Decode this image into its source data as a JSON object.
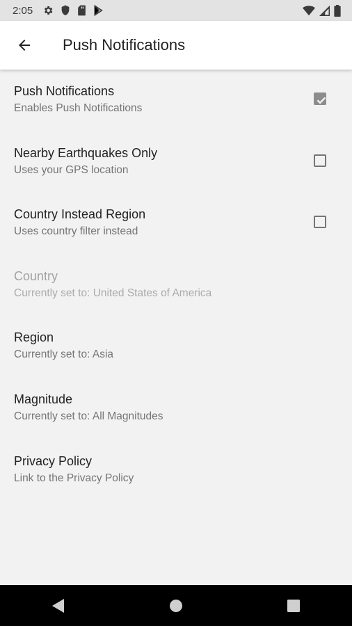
{
  "status_bar": {
    "time": "2:05",
    "left_icons": [
      "gear-icon",
      "shield-icon",
      "sd-card-icon",
      "play-store-icon"
    ],
    "right_icons": [
      "wifi-icon",
      "signal-icon",
      "battery-icon"
    ]
  },
  "app_bar": {
    "title": "Push Notifications",
    "back_icon": "arrow-left-icon"
  },
  "preferences": [
    {
      "title": "Push Notifications",
      "summary": "Enables Push Notifications",
      "checkbox": true,
      "checked": true,
      "enabled": true
    },
    {
      "title": "Nearby Earthquakes Only",
      "summary": "Uses your GPS location",
      "checkbox": true,
      "checked": false,
      "enabled": true
    },
    {
      "title": "Country Instead Region",
      "summary": "Uses country filter instead",
      "checkbox": true,
      "checked": false,
      "enabled": true
    },
    {
      "title": "Country",
      "summary": "Currently set to: United States of America",
      "checkbox": false,
      "enabled": false
    },
    {
      "title": "Region",
      "summary": "Currently set to: Asia",
      "checkbox": false,
      "enabled": true
    },
    {
      "title": "Magnitude",
      "summary": "Currently set to: All Magnitudes",
      "checkbox": false,
      "enabled": true
    },
    {
      "title": "Privacy Policy",
      "summary": "Link to the Privacy Policy",
      "checkbox": false,
      "enabled": true
    }
  ],
  "nav_bar": {
    "buttons": [
      "back-triangle-icon",
      "home-circle-icon",
      "recents-square-icon"
    ]
  },
  "colors": {
    "background": "#f2f2f2",
    "app_bar": "#ffffff",
    "status_bar": "#e3e3e3",
    "checked_box": "#8c8c8c",
    "nav_bar": "#000000"
  }
}
